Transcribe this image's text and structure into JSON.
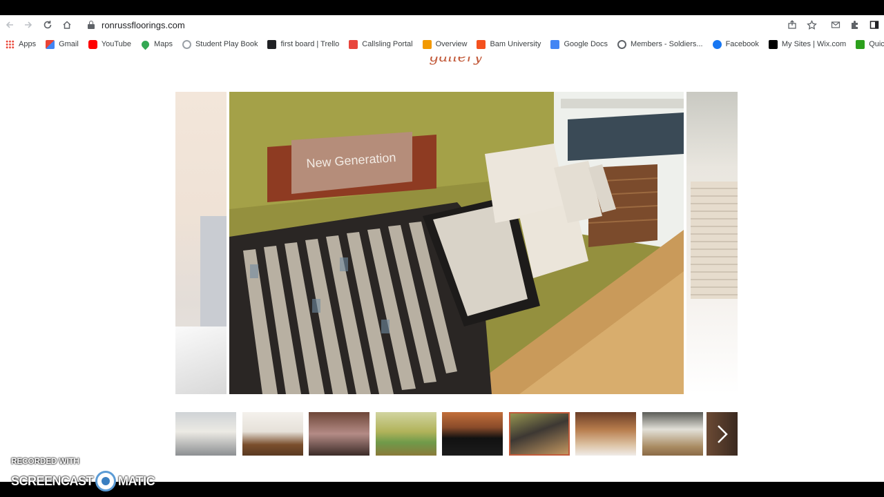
{
  "browser": {
    "url": "ronrussfloorings.com",
    "bookmarks": [
      {
        "label": "Apps",
        "icon": "apps-grid-icon",
        "color": "#4285f4"
      },
      {
        "label": "Gmail",
        "icon": "gmail-icon",
        "color": "#ea4335"
      },
      {
        "label": "YouTube",
        "icon": "youtube-icon",
        "color": "#ff0000"
      },
      {
        "label": "Maps",
        "icon": "maps-pin-icon",
        "color": "#34a853"
      },
      {
        "label": "Student Play Book",
        "icon": "globe-icon",
        "color": "#9aa0a6"
      },
      {
        "label": "first board | Trello",
        "icon": "trello-icon",
        "color": "#202124"
      },
      {
        "label": "Callsling Portal",
        "icon": "callsling-icon",
        "color": "#e8453c"
      },
      {
        "label": "Overview",
        "icon": "overview-icon",
        "color": "#f29900"
      },
      {
        "label": "Bam University",
        "icon": "bam-icon",
        "color": "#f4511e"
      },
      {
        "label": "Google Docs",
        "icon": "google-docs-icon",
        "color": "#4285f4"
      },
      {
        "label": "Members - Soldiers...",
        "icon": "globe-icon",
        "color": "#5f6368"
      },
      {
        "label": "Facebook",
        "icon": "facebook-icon",
        "color": "#1877f2"
      },
      {
        "label": "My Sites | Wix.com",
        "icon": "wix-icon",
        "color": "#000000"
      },
      {
        "label": "QuickBoo",
        "icon": "quickbooks-icon",
        "color": "#2ca01c"
      }
    ]
  },
  "gallery": {
    "title": "gallery",
    "main_sign_text": "New Generation",
    "thumbnail_count": 9,
    "active_index": 5
  },
  "watermark": {
    "line1": "RECORDED WITH",
    "line2_left": "SCREENCAST",
    "line2_right": "MATIC"
  }
}
